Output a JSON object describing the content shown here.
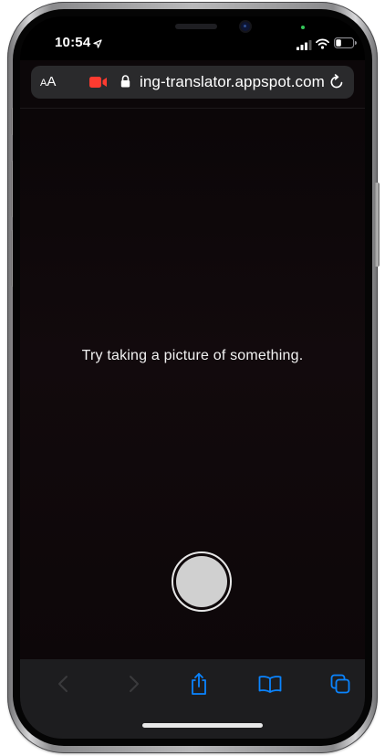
{
  "status_bar": {
    "time": "10:54",
    "icons": [
      "location-arrow-icon",
      "signal-icon",
      "wifi-icon",
      "battery-icon"
    ]
  },
  "url_bar": {
    "text_size_label": "AA",
    "url": "ing-translator.appspot.com",
    "icons": [
      "video-camera-icon",
      "lock-icon",
      "reload-icon"
    ],
    "recording_color": "#ff3b30"
  },
  "camera_view": {
    "hint": "Try taking a picture of something."
  },
  "toolbar": {
    "items": [
      "back-icon",
      "forward-icon",
      "share-icon",
      "bookmarks-icon",
      "tabs-icon"
    ],
    "accent_color": "#0a84ff"
  }
}
